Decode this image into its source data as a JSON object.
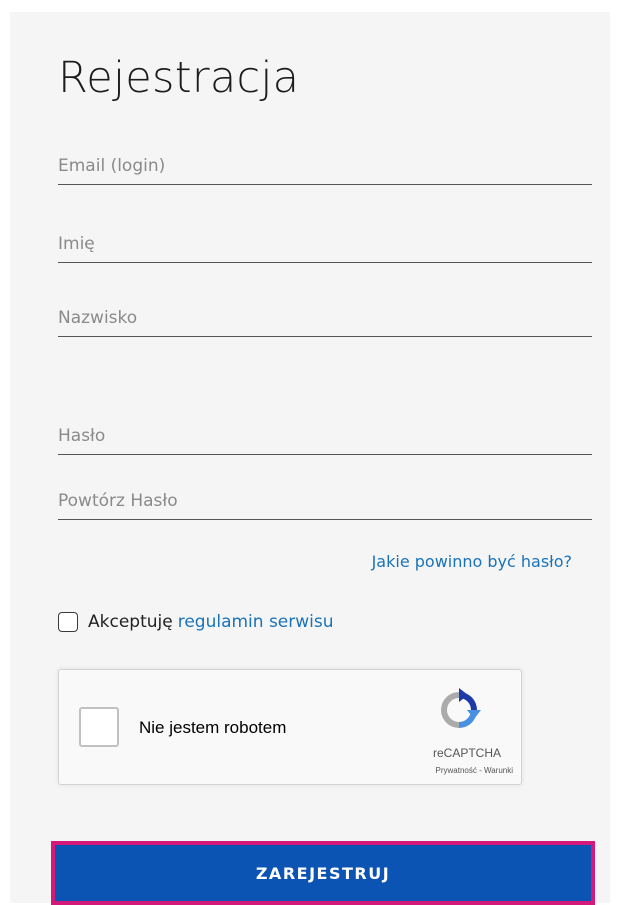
{
  "form": {
    "title": "Rejestracja",
    "fields": {
      "email": {
        "placeholder": "Email (login)",
        "value": ""
      },
      "first_name": {
        "placeholder": "Imię",
        "value": ""
      },
      "last_name": {
        "placeholder": "Nazwisko",
        "value": ""
      },
      "password": {
        "placeholder": "Hasło",
        "value": ""
      },
      "password_repeat": {
        "placeholder": "Powtórz Hasło",
        "value": ""
      }
    },
    "password_hint_link": "Jakie powinno być hasło?",
    "terms": {
      "prefix": "Akceptuję",
      "link": "regulamin serwisu",
      "checked": false
    },
    "submit_label": "ZAREJESTRUJ"
  },
  "recaptcha": {
    "label": "Nie jestem robotem",
    "brand": "reCAPTCHA",
    "legal": "Prywatność - Warunki",
    "checked": false,
    "icon": "recaptcha-logo-icon"
  },
  "colors": {
    "panel_background": "#f5f5f5",
    "link": "#1a73b8",
    "button": "#0c54b4",
    "button_highlight_border": "#d4197a"
  }
}
